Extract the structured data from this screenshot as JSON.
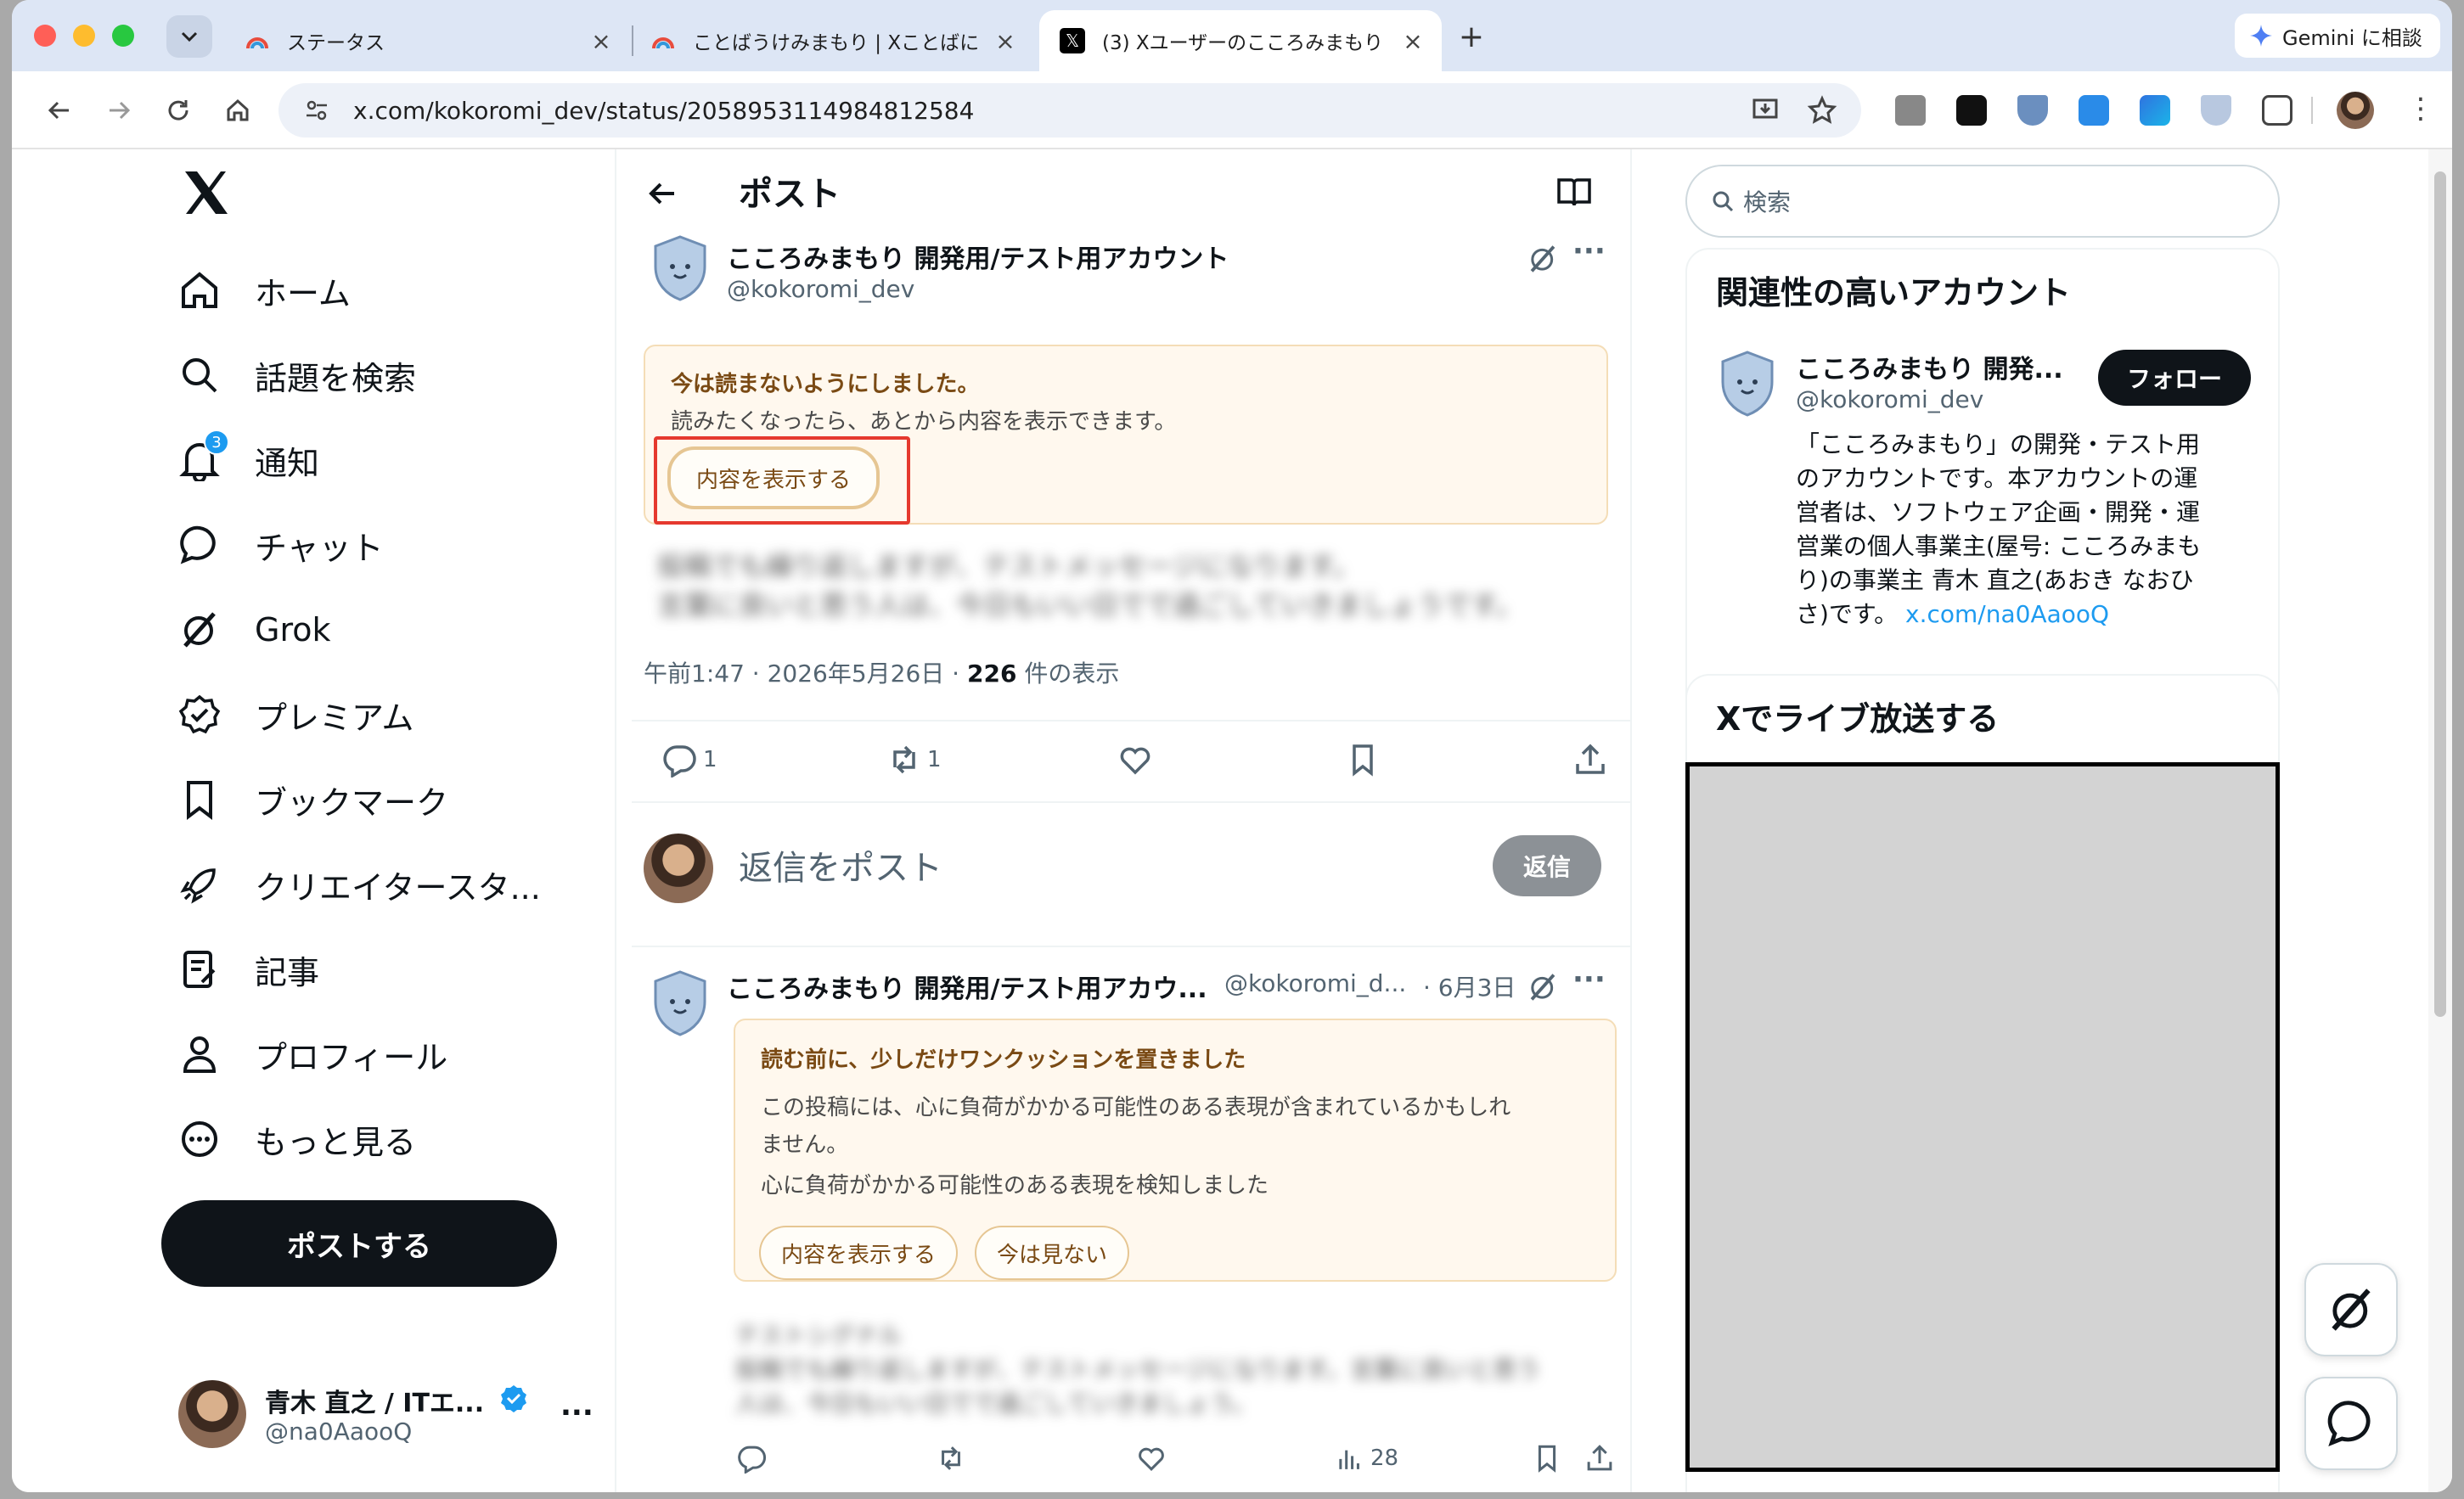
{
  "browser": {
    "tabs": [
      {
        "title": "ステータス"
      },
      {
        "title": "ことばうけみまもり | Xことばに"
      },
      {
        "title": "(3) Xユーザーのこころみまもり"
      }
    ],
    "url": "x.com/kokoromi_dev/status/2058953114984812584",
    "gemini_label": "Gemini に相談"
  },
  "nav": {
    "items": [
      {
        "label": "ホーム"
      },
      {
        "label": "話題を検索"
      },
      {
        "label": "通知"
      },
      {
        "label": "チャット"
      },
      {
        "label": "Grok"
      },
      {
        "label": "プレミアム"
      },
      {
        "label": "ブックマーク"
      },
      {
        "label": "クリエイタースタ..."
      },
      {
        "label": "記事"
      },
      {
        "label": "プロフィール"
      },
      {
        "label": "もっと見る"
      }
    ],
    "notification_badge": "3",
    "post_button": "ポストする",
    "account": {
      "name": "青木 直之 / ITエ...",
      "handle": "@na0AaooQ",
      "more": "..."
    }
  },
  "main": {
    "header_title": "ポスト",
    "post": {
      "author_name": "こころみまもり 開発用/テスト用アカウント",
      "author_handle": "@kokoromi_dev",
      "warning_title": "今は読まないようにしました。",
      "warning_body": "読みたくなったら、あとから内容を表示できます。",
      "show_button": "内容を表示する",
      "blurred_line1": "投稿でも繰り返しますが、テストメッセージになります。",
      "blurred_line2": "言葉に良いと思う人は、今日もいい日でで過ごしていきましょうです。",
      "time": "午前1:47 · 2026年5月26日 · ",
      "views": "226",
      "views_label": " 件の表示",
      "reply_count": "1",
      "repost_count": "1"
    },
    "reply": {
      "placeholder": "返信をポスト",
      "button": "返信"
    },
    "second_post": {
      "author_name": "こころみまもり 開発用/テスト用アカウ...",
      "author_handle": "@kokoromi_d...",
      "date": "· 6月3日",
      "warning_title": "読む前に、少しだけワンクッションを置きました",
      "warning_body1": "この投稿には、心に負荷がかかる可能性のある表現が含まれているかもしれ",
      "warning_body2": "ません。",
      "warning_body3": "心に負荷がかかる可能性のある表現を検知しました",
      "show_button": "内容を表示する",
      "skip_button": "今は見ない",
      "blurred_line1": "テストシグナル",
      "blurred_line2": "投稿でも繰り返しますが、テストメッセージになります。言葉に良いと思う",
      "blurred_line3": "人は、今日もいい日でで過ごしていきましょう。",
      "views": "28"
    }
  },
  "right": {
    "search_placeholder": "検索",
    "related_title": "関連性の高いアカウント",
    "account": {
      "name": "こころみまもり 開発...",
      "handle": "@kokoromi_dev",
      "follow": "フォロー",
      "bio_lines": [
        "「こころみまもり」の開発・テスト用",
        "のアカウントです。本アカウントの運",
        "営者は、ソフトウェア企画・開発・運",
        "営業の個人事業主(屋号: こころみまも",
        "り)の事業主 青木 直之(あおき なおひ"
      ],
      "bio_last": "さ)です。",
      "bio_link": "x.com/na0AaooQ"
    },
    "live_title": "Xでライブ放送する"
  }
}
